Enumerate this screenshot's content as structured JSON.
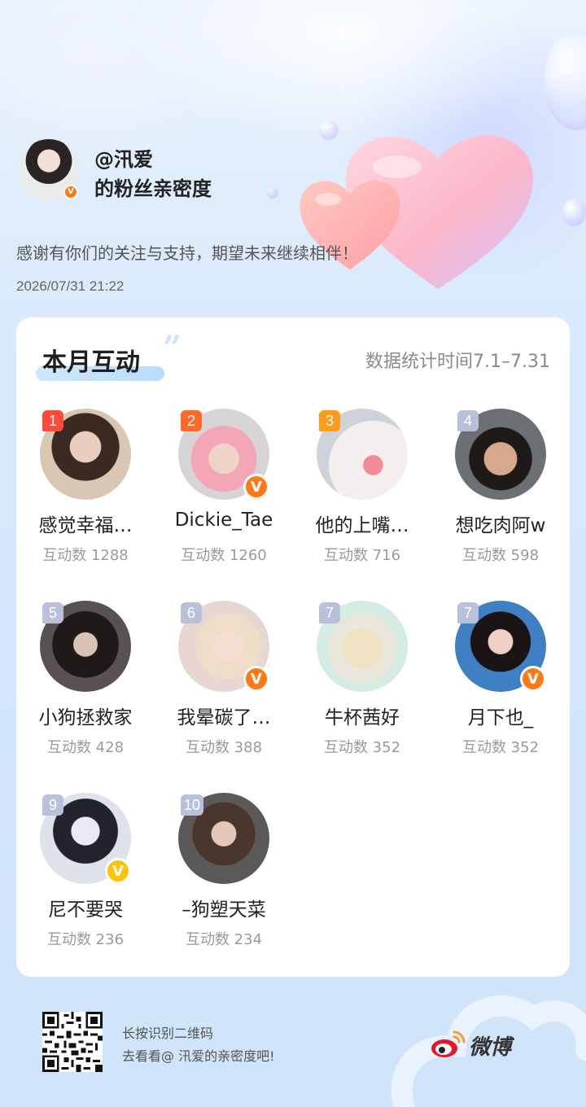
{
  "header": {
    "name": "@汛爱",
    "subtitle": "的粉丝亲密度",
    "thanks": "感谢有你们的关注与支持，期望未来继续相伴！",
    "datetime": "2026/07/31 21:22",
    "verified_badge": "V"
  },
  "card": {
    "title": "本月互动",
    "quote_mark": "”",
    "period": "数据统计时间7.1–7.31"
  },
  "fans": [
    {
      "rank": "1",
      "name": "感觉幸福…",
      "count": "互动数 1288",
      "rank_color": "#ff4b3a",
      "verified": false,
      "avatar": "girl-longhair-icon"
    },
    {
      "rank": "2",
      "name": "Dickie_Tae",
      "count": "互动数 1260",
      "rank_color": "#ff6a2a",
      "verified": true,
      "badge_color": "#ff7a15",
      "avatar": "pink-hair-icon"
    },
    {
      "rank": "3",
      "name": "他的上嘴…",
      "count": "互动数 716",
      "rank_color": "#ff9a1a",
      "verified": false,
      "avatar": "piglet-icon"
    },
    {
      "rank": "4",
      "name": "想吃肉阿w",
      "count": "互动数 598",
      "rank_color": "#b9c0d9",
      "verified": false,
      "avatar": "child-icon"
    },
    {
      "rank": "5",
      "name": "小狗拯救家",
      "count": "互动数 428",
      "rank_color": "#b9c0d9",
      "verified": false,
      "avatar": "dark-hair-icon"
    },
    {
      "rank": "6",
      "name": "我晕碳了…",
      "count": "互动数 388",
      "rank_color": "#b9c0d9",
      "verified": true,
      "badge_color": "#ff7a15",
      "avatar": "blonde-girl-icon"
    },
    {
      "rank": "7",
      "name": "牛杯茜好",
      "count": "互动数 352",
      "rank_color": "#b9c0d9",
      "verified": false,
      "avatar": "cartoon-icon"
    },
    {
      "rank": "7",
      "name": "月下也_",
      "count": "互动数 352",
      "rank_color": "#b9c0d9",
      "verified": true,
      "badge_color": "#ff7a15",
      "avatar": "bangs-girl-icon"
    },
    {
      "rank": "9",
      "name": "尼不要哭",
      "count": "互动数 236",
      "rank_color": "#b9c0d9",
      "verified": true,
      "badge_color": "#ffc400",
      "avatar": "anime-cat-icon"
    },
    {
      "rank": "10",
      "name": "–狗塑天菜",
      "count": "互动数 234",
      "rank_color": "#b9c0d9",
      "verified": false,
      "avatar": "brown-hair-icon"
    }
  ],
  "footer": {
    "line1": "长按识别二维码",
    "line2": "去看看@ 汛爱的亲密度吧!",
    "brand": "微博"
  }
}
